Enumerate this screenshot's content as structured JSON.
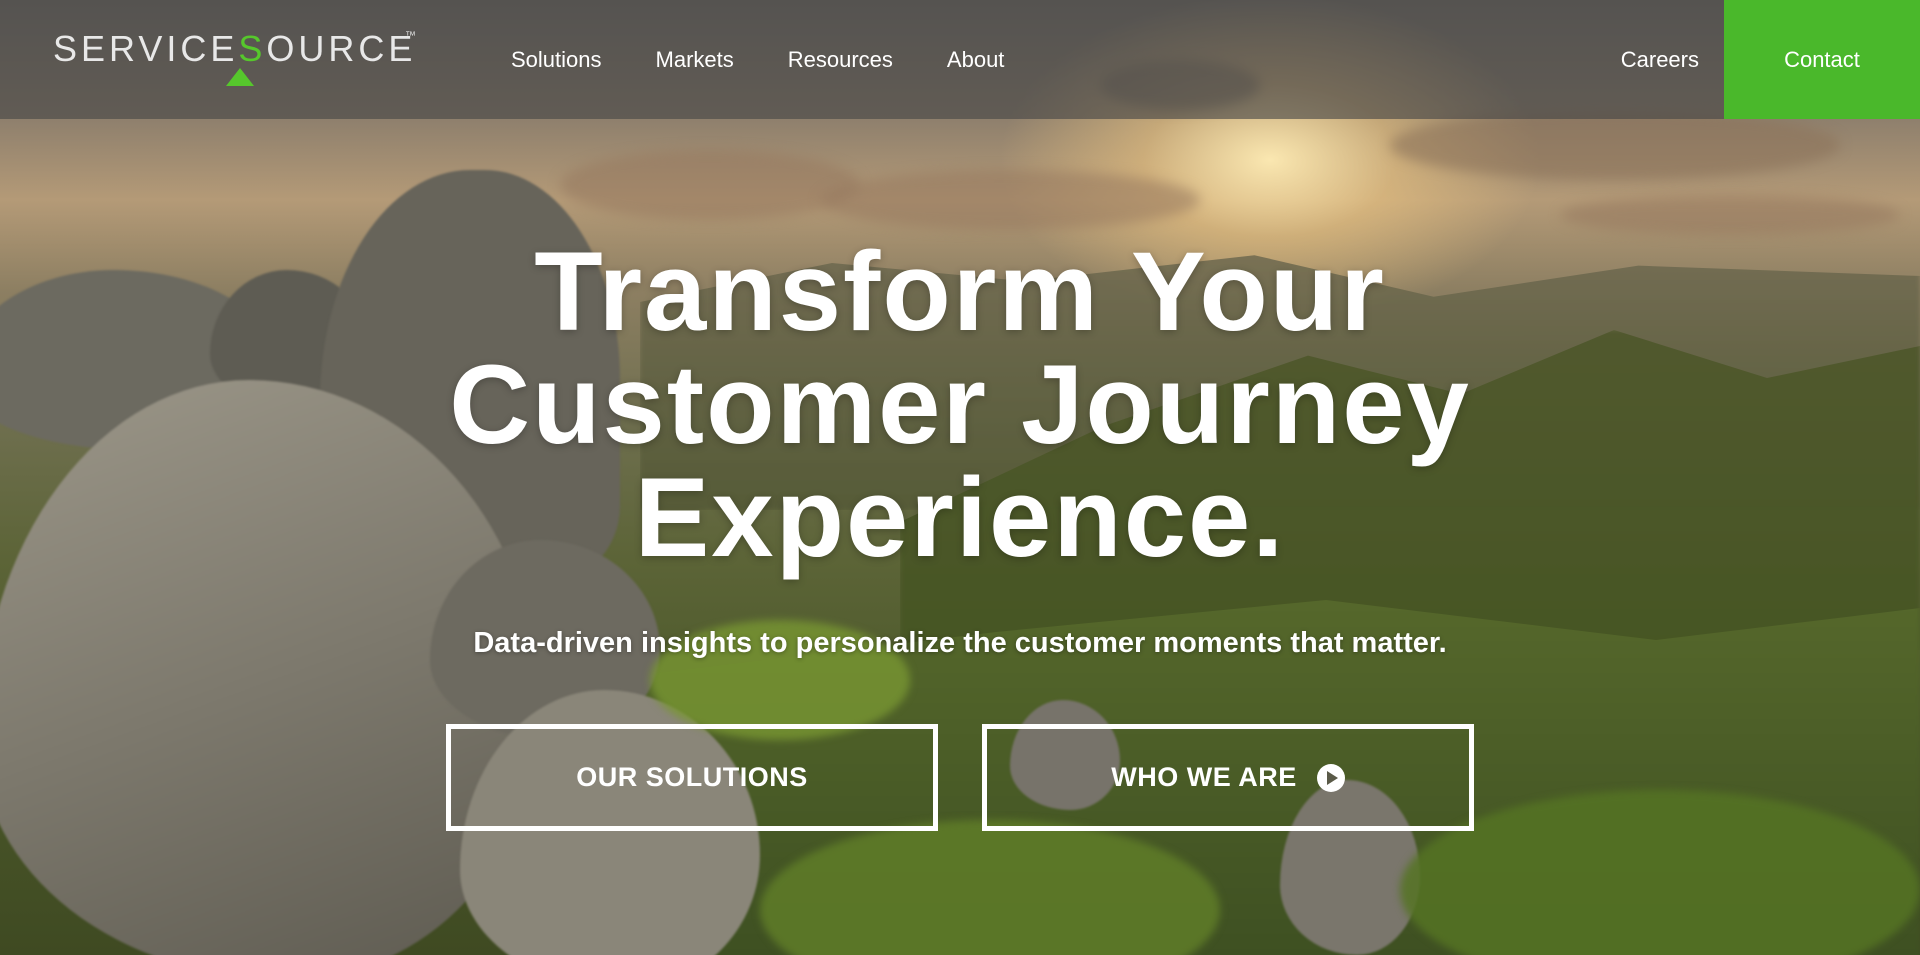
{
  "brand": {
    "logo_part1": "SERVICE",
    "logo_accent": "S",
    "logo_part2": "OURCE",
    "trademark": "™",
    "accent_color": "#4ab82b"
  },
  "nav": {
    "items": [
      {
        "label": "Solutions"
      },
      {
        "label": "Markets"
      },
      {
        "label": "Resources"
      },
      {
        "label": "About"
      }
    ],
    "careers": "Careers",
    "contact": "Contact"
  },
  "hero": {
    "title_line1": "Transform Your",
    "title_line2": "Customer Journey",
    "title_line3": "Experience.",
    "subtitle": "Data-driven insights to personalize the customer moments that matter.",
    "cta_primary": "OUR SOLUTIONS",
    "cta_secondary": "WHO WE ARE",
    "cta_secondary_icon": "play-circle-icon"
  }
}
